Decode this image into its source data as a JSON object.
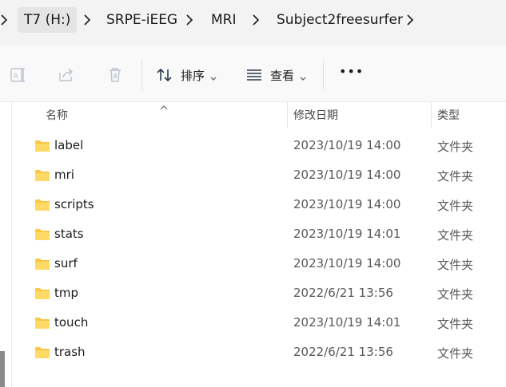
{
  "breadcrumb": {
    "items": [
      "T7 (H:)",
      "SRPE-iEEG",
      "MRI",
      "Subject2freesurfer"
    ]
  },
  "toolbar": {
    "sort_label": "排序",
    "view_label": "查看",
    "more_label": "•••"
  },
  "columns": {
    "name": "名称",
    "modified": "修改日期",
    "type": "类型"
  },
  "files": [
    {
      "name": "label",
      "modified": "2023/10/19 14:00",
      "type": "文件夹"
    },
    {
      "name": "mri",
      "modified": "2023/10/19 14:00",
      "type": "文件夹"
    },
    {
      "name": "scripts",
      "modified": "2023/10/19 14:00",
      "type": "文件夹"
    },
    {
      "name": "stats",
      "modified": "2023/10/19 14:01",
      "type": "文件夹"
    },
    {
      "name": "surf",
      "modified": "2023/10/19 14:00",
      "type": "文件夹"
    },
    {
      "name": "tmp",
      "modified": "2022/6/21 13:56",
      "type": "文件夹"
    },
    {
      "name": "touch",
      "modified": "2023/10/19 14:01",
      "type": "文件夹"
    },
    {
      "name": "trash",
      "modified": "2022/6/21 13:56",
      "type": "文件夹"
    }
  ],
  "icons": {
    "folder_color": "#f8c846"
  }
}
